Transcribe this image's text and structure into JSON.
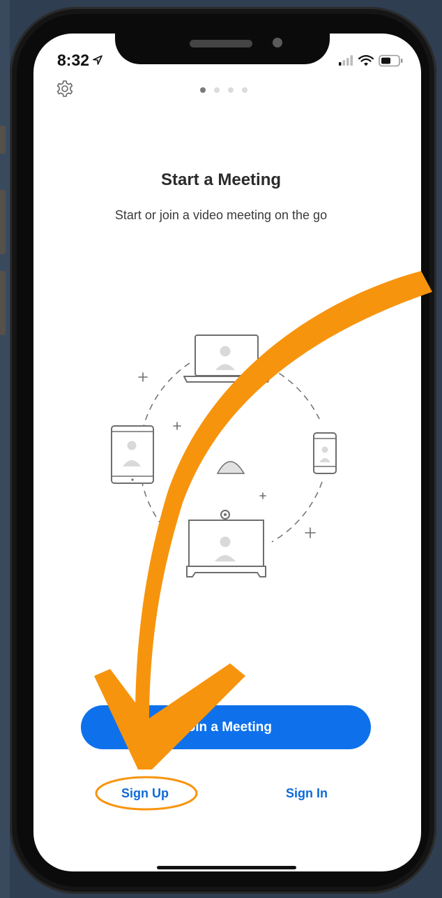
{
  "status_bar": {
    "time": "8:32",
    "icons": [
      "location-icon",
      "signal-icon",
      "wifi-icon",
      "battery-icon"
    ]
  },
  "header": {
    "settings_icon": "gear-icon",
    "page_indicator": {
      "total": 4,
      "current": 1
    }
  },
  "onboarding": {
    "title": "Start a Meeting",
    "subtitle": "Start or join a video meeting on the go"
  },
  "actions": {
    "join_label": "Join a Meeting",
    "signup_label": "Sign Up",
    "signin_label": "Sign In"
  },
  "colors": {
    "accent": "#0e71eb",
    "link": "#0e6ad8",
    "annotation": "#f7940d",
    "background": "#2f3e51"
  }
}
